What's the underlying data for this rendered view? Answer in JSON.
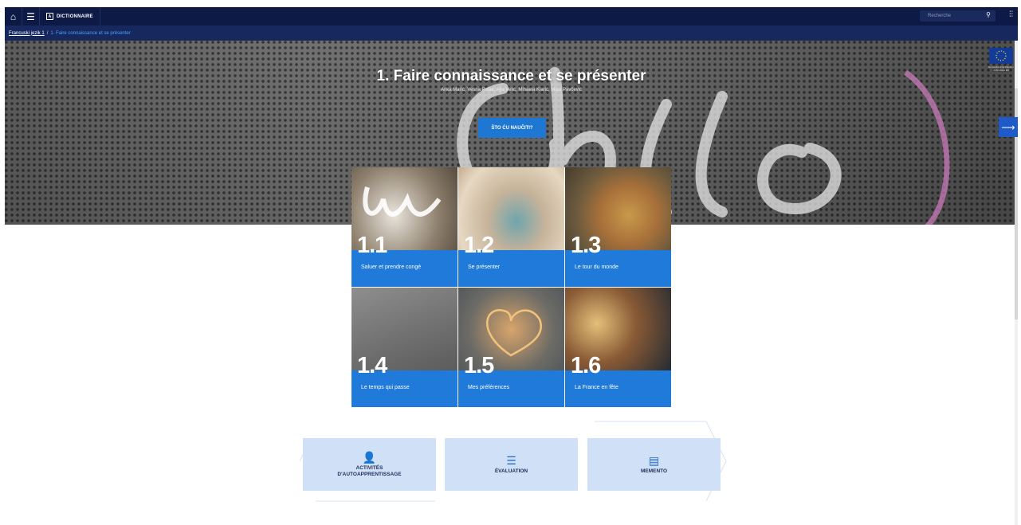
{
  "topbar": {
    "dictionary_label": "DICTIONNAIRE",
    "dictionary_box": "A",
    "search_placeholder": "Recherche"
  },
  "breadcrumb": {
    "parent": "Francuski jezik 1",
    "separator": "/",
    "current": "1. Faire connaissance et se présenter"
  },
  "hero": {
    "title": "1. Faire connaissance et se présenter",
    "authors": "Anka Marić, Vesna Polak, Ajla Velić, Mihaela Klarić, Maja Pavčević",
    "button_label": "ŠTO ĆU NAUČITI?",
    "eu_caption": "Europska unija Zajedno do fondova EU"
  },
  "units": [
    {
      "number": "1.1",
      "label": "Saluer et prendre congé"
    },
    {
      "number": "1.2",
      "label": "Se présenter"
    },
    {
      "number": "1.3",
      "label": "Le tour du monde"
    },
    {
      "number": "1.4",
      "label": "Le temps qui passe"
    },
    {
      "number": "1.5",
      "label": "Mes préférences"
    },
    {
      "number": "1.6",
      "label": "La France en fête"
    }
  ],
  "features": [
    {
      "label_line1": "ACTIVITÉS",
      "label_line2": "D'AUTOAPPRENTISSAGE",
      "icon": "student-icon"
    },
    {
      "label_line1": "ÉVALUATION",
      "label_line2": "",
      "icon": "checklist-icon"
    },
    {
      "label_line1": "MEMENTO",
      "label_line2": "",
      "icon": "document-icon"
    }
  ],
  "colors": {
    "topbar": "#0c1a45",
    "breadcrumb": "#16285e",
    "accent": "#1f7ad9",
    "tile": "#cfe0f7"
  }
}
